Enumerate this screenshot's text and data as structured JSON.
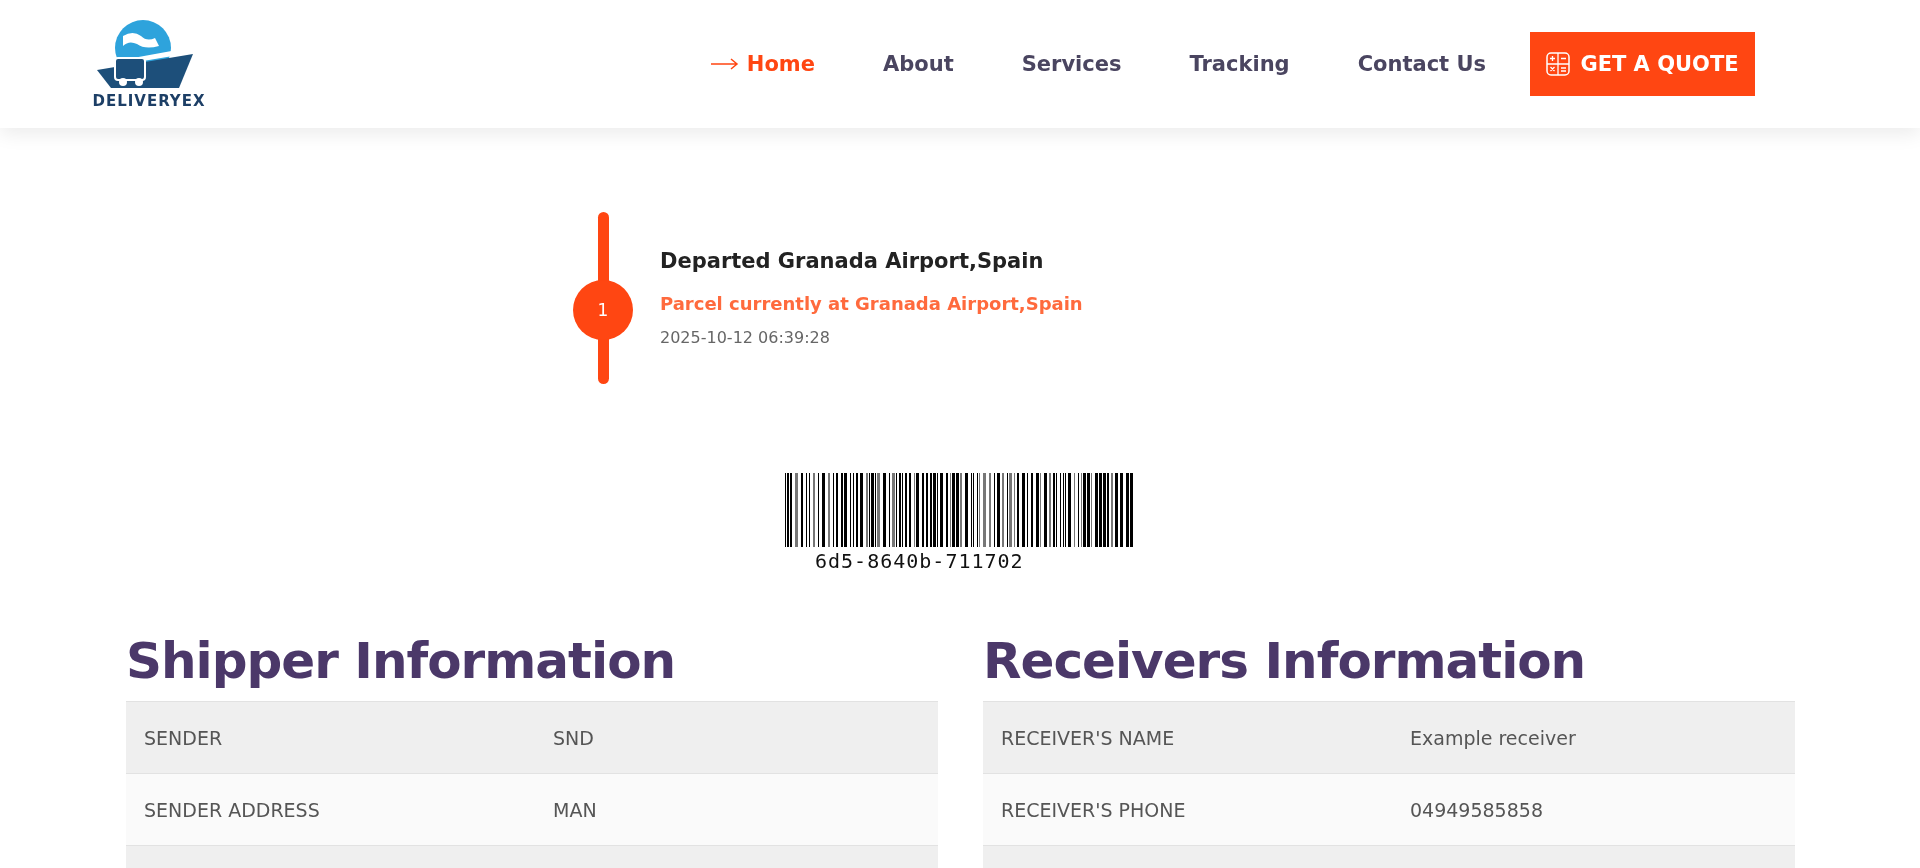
{
  "header": {
    "logo": {
      "text": "DELIVERYEX"
    },
    "nav": [
      {
        "label": "Home",
        "selected": true
      },
      {
        "label": "About",
        "selected": false
      },
      {
        "label": "Services",
        "selected": false
      },
      {
        "label": "Tracking",
        "selected": false
      },
      {
        "label": "Contact Us",
        "selected": false
      }
    ],
    "quote_button": {
      "label": "GET A QUOTE"
    }
  },
  "timeline": [
    {
      "step": "1",
      "title": "Departed Granada Airport,Spain",
      "status": "Parcel currently at Granada Airport,Spain",
      "time": "2025-10-12 06:39:28"
    }
  ],
  "barcode": {
    "code": "6d5-8640b-711702"
  },
  "sections": [
    {
      "title": "Shipper Information",
      "rows": [
        {
          "label": "SENDER",
          "value": "SND"
        },
        {
          "label": "SENDER ADDRESS",
          "value": "MAN"
        }
      ]
    },
    {
      "title": "Receivers Information",
      "rows": [
        {
          "label": "RECEIVER'S NAME",
          "value": "Example receiver"
        },
        {
          "label": "RECEIVER'S PHONE",
          "value": "04949585858"
        }
      ]
    }
  ]
}
